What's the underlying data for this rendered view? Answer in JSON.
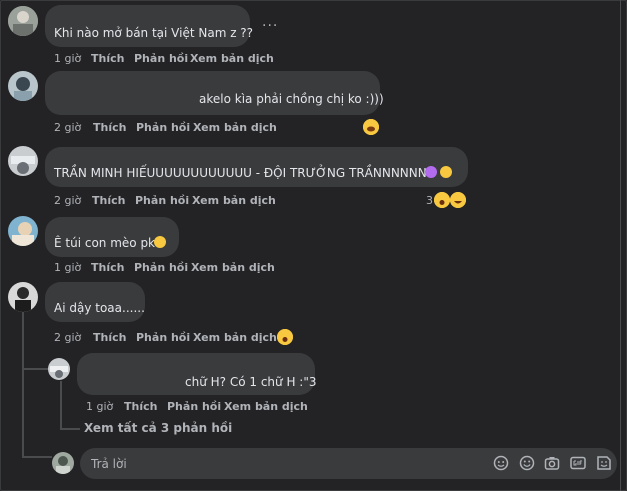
{
  "meta_labels": {
    "like": "Thích",
    "reply": "Phản hồi",
    "translate": "Xem bản dịch"
  },
  "comments": [
    {
      "text": "Khi nào mở bán tại Việt Nam z ??",
      "time": "1 giờ"
    },
    {
      "text": "akelo kìa phải chồng chị ko :)))",
      "time": "2 giờ"
    },
    {
      "text": "TRẦN MINH HIẾUUUUUUUUUUUU - ĐỘI TRƯỞNG TRẦNNNNNNN",
      "time": "2 giờ",
      "reaction_count": "3"
    },
    {
      "text": "Ê túi con mèo pk",
      "time": "1 giờ"
    },
    {
      "text": "Ai dậy toaa......",
      "time": "2 giờ"
    }
  ],
  "reply": {
    "text": "chữ H? Có 1 chữ H :\"3",
    "time": "1 giờ"
  },
  "view_replies": "Xem tất cả 3 phản hồi",
  "composer": {
    "placeholder": "Trả lời"
  },
  "more_options": "···"
}
